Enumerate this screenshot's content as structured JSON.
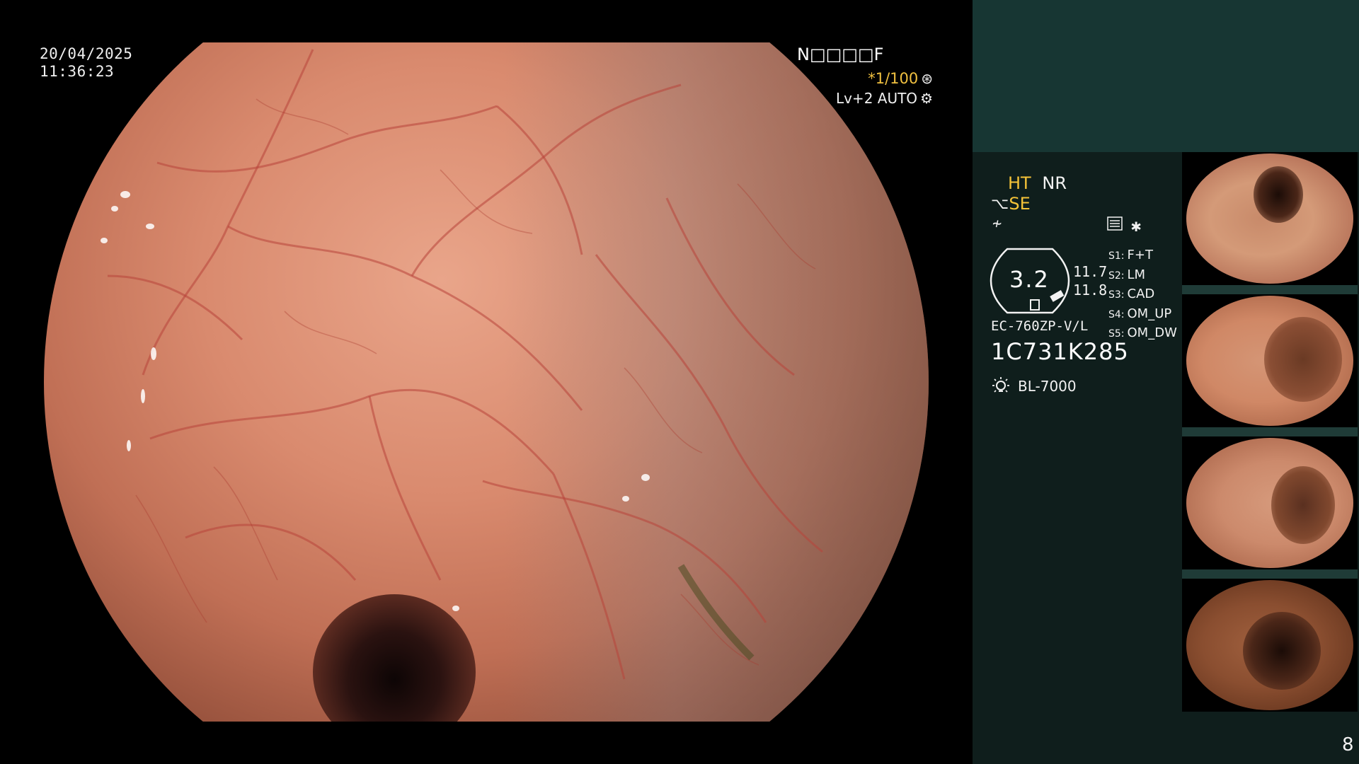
{
  "overlay": {
    "date": "20/04/2025",
    "time": "11:36:23",
    "patient_code": "N□□□□F",
    "shutter": "*1/100",
    "level": "Lv+2 AUTO"
  },
  "panel": {
    "mode_ht": "HT",
    "mode_nr": "NR",
    "mode_se": "SE",
    "zoom_value": "3.2",
    "value_a": "11.7",
    "value_b": "11.8",
    "scope_model": "EC-760ZP-V/L",
    "scope_serial": "1C731K285",
    "light_source": "BL-7000",
    "shortcuts": [
      {
        "key": "S1:",
        "label": "F+T"
      },
      {
        "key": "S2:",
        "label": "LM"
      },
      {
        "key": "S3:",
        "label": "CAD"
      },
      {
        "key": "S4:",
        "label": "OM_UP"
      },
      {
        "key": "S5:",
        "label": "OM_DW"
      }
    ],
    "page_number": "8"
  },
  "icons": [
    "shutter-icon",
    "auto-iris-icon",
    "endoscope-icon",
    "noise-icon",
    "menu-icon",
    "star-icon",
    "zoom-badge-icon",
    "light-bulb-icon"
  ],
  "colors": {
    "accent_yellow": "#f5c338",
    "panel_dark": "#0f1e1c",
    "panel_top": "#173633"
  }
}
